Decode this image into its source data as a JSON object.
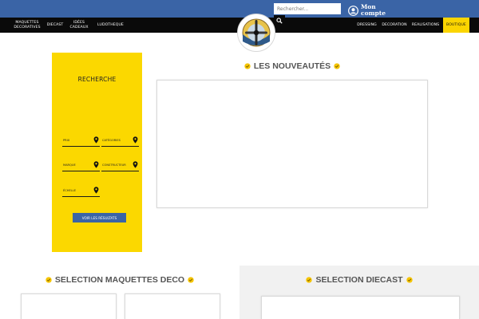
{
  "header": {
    "search_placeholder": "Rechercher...",
    "account_label": "Mon compte"
  },
  "nav": {
    "left": [
      "MAQUETTES DECORATIVES",
      "DIECAST",
      "IDÉES CADEAUX",
      "LUDOTHEQUE"
    ],
    "right": [
      "DRESSING",
      "DECORATION",
      "REALISATIONS",
      "BOUTIQUE"
    ],
    "active": "BOUTIQUE"
  },
  "search_panel": {
    "title": "RECHERCHE",
    "fields": {
      "prix": "PRIX",
      "categories": "CATÉGORIES",
      "marque": "MARQUE",
      "constructeur": "CONSTRUCTEUR",
      "echelle": "ÉCHELLE"
    },
    "results_button": "VOIR LES RÉSULTATS"
  },
  "sections": {
    "nouveautes": "LES NOUVEAUTÉS",
    "maquettes_deco": "SELECTION MAQUETTES DECO",
    "diecast": "SELECTION DIECAST"
  },
  "colors": {
    "topbar_blue": "#3a64a6",
    "nav_black": "#0a0a0a",
    "accent_yellow": "#fbd800",
    "heading_grey": "#555555",
    "section_grey": "#f1f1f1"
  },
  "icons": {
    "account": "user-circle-icon",
    "search": "magnifier-icon",
    "field_marker": "map-pin-icon",
    "heading_marker": "yellow-check-badge-icon",
    "logo": "airplane-propeller-logo"
  }
}
